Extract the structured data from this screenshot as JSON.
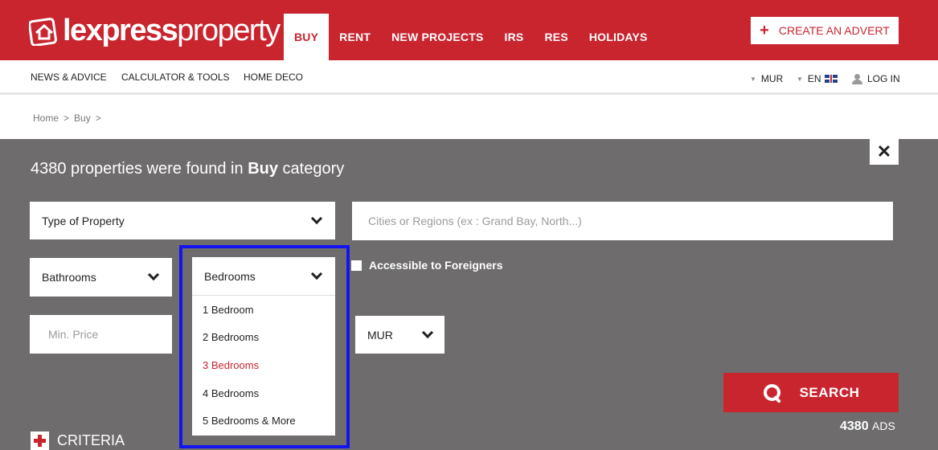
{
  "brand": {
    "logo_bold": "lexpress",
    "logo_light": "property",
    "color": "#c9252f"
  },
  "main_nav": [
    {
      "label": "BUY",
      "active": true
    },
    {
      "label": "RENT"
    },
    {
      "label": "NEW PROJECTS"
    },
    {
      "label": "IRS"
    },
    {
      "label": "RES"
    },
    {
      "label": "HOLIDAYS"
    }
  ],
  "create_advert": {
    "icon": "plus-icon",
    "label": "CREATE AN ADVERT"
  },
  "sub_nav": {
    "links": [
      "NEWS & ADVICE",
      "CALCULATOR & TOOLS",
      "HOME DECO"
    ],
    "currency": "MUR",
    "language": "EN",
    "login": "LOG IN"
  },
  "breadcrumb": {
    "items": [
      "Home",
      "Buy"
    ],
    "separator": ">"
  },
  "search_panel": {
    "close_label": "✕",
    "results": {
      "count": "4380",
      "text_before": " properties were found in ",
      "category": "Buy",
      "text_after": " category"
    },
    "type_of_property": "Type of Property",
    "cities_placeholder": "Cities or Regions (ex : Grand Bay, North...)",
    "bathrooms": "Bathrooms",
    "bedrooms": {
      "label": "Bedrooms",
      "options": [
        "1 Bedroom",
        "2 Bedrooms",
        "3 Bedrooms",
        "4 Bedrooms",
        "5 Bedrooms & More"
      ],
      "hovered_option": "3 Bedrooms"
    },
    "accessible_foreigners": "Accessible to Foreigners",
    "min_price_placeholder": "Min. Price",
    "currency_select": "MUR",
    "search_label": "SEARCH",
    "ads_count": "4380",
    "ads_label": "ADS",
    "criteria_label": "CRITERIA"
  }
}
